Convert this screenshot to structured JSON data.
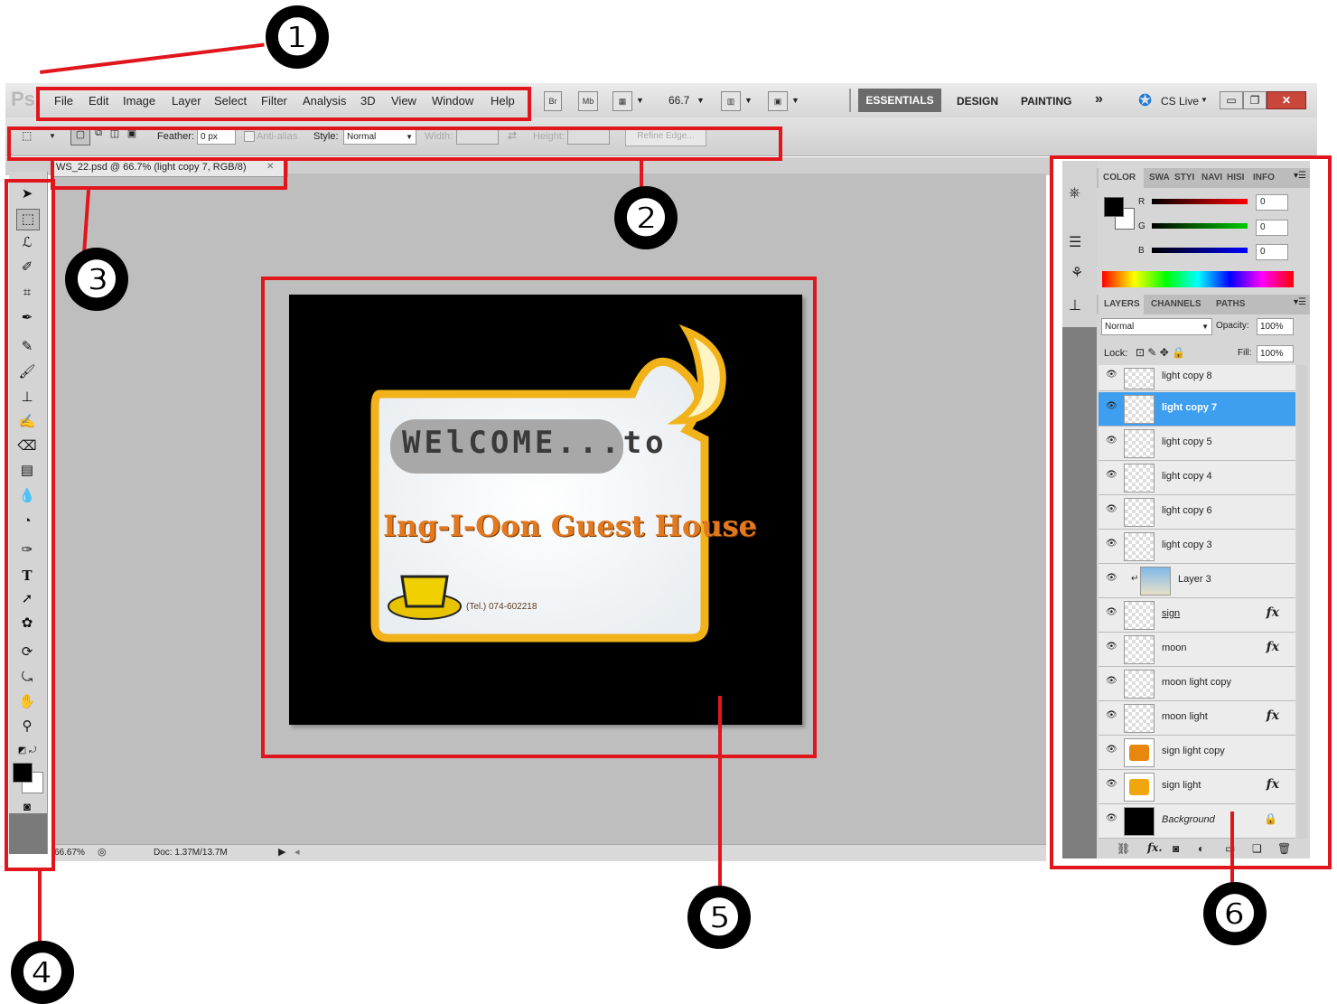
{
  "app": {
    "logo": "Ps"
  },
  "menu": [
    "File",
    "Edit",
    "Image",
    "Layer",
    "Select",
    "Filter",
    "Analysis",
    "3D",
    "View",
    "Window",
    "Help"
  ],
  "app_bar": {
    "br": "Br",
    "mb": "Mb",
    "zoom": "66.7",
    "zoom_arrow": "▼"
  },
  "workspaces": {
    "essentials": "ESSENTIALS",
    "design": "DESIGN",
    "painting": "PAINTING",
    "more": "»",
    "cslive": "CS Live"
  },
  "options": {
    "feather_label": "Feather:",
    "feather_value": "0 px",
    "antialias_label": "Anti-alias",
    "style_label": "Style:",
    "style_value": "Normal",
    "width_label": "Width:",
    "height_label": "Height:",
    "refine_edge": "Refine Edge..."
  },
  "document": {
    "tab_title": "WS_22.psd @ 66.7% (light copy 7, RGB/8)",
    "close": "✕",
    "zoom_status": "66.67%",
    "doc_size": "Doc: 1.37M/13.7M"
  },
  "image": {
    "welcome": "WElCOME...to",
    "name": "Ing-I-Oon Guest House",
    "tel": "(Tel.) 074-602218"
  },
  "colors": {
    "accent": "#3e9ff0",
    "annotation": "#e0161c",
    "panel": "#d6d6d6",
    "essentials_bg": "#6b6b6b"
  },
  "color_panel": {
    "tabs": [
      "COLOR",
      "SWA",
      "STYI",
      "NAVI",
      "HISI",
      "INFO"
    ],
    "r_label": "R",
    "g_label": "G",
    "b_label": "B",
    "r": "0",
    "g": "0",
    "b": "0"
  },
  "layers_panel": {
    "tabs": [
      "LAYERS",
      "CHANNELS",
      "PATHS"
    ],
    "blend_mode": "Normal",
    "opacity_label": "Opacity:",
    "opacity": "100%",
    "lock_label": "Lock:",
    "fill_label": "Fill:",
    "fill": "100%",
    "layers": [
      {
        "name": "light copy 8",
        "fx": ""
      },
      {
        "name": "light copy 7",
        "fx": ""
      },
      {
        "name": "light copy 5",
        "fx": ""
      },
      {
        "name": "light copy 4",
        "fx": ""
      },
      {
        "name": "light copy 6",
        "fx": ""
      },
      {
        "name": "light copy 3",
        "fx": ""
      },
      {
        "name": "Layer 3",
        "fx": ""
      },
      {
        "name": "sign",
        "fx": "fx"
      },
      {
        "name": "moon",
        "fx": "fx"
      },
      {
        "name": "moon light copy",
        "fx": ""
      },
      {
        "name": "moon light",
        "fx": "fx"
      },
      {
        "name": "sign light copy",
        "fx": ""
      },
      {
        "name": "sign light",
        "fx": "fx"
      },
      {
        "name": "Background",
        "fx": ""
      }
    ],
    "footer_fx": "fx."
  },
  "annotations": [
    "❶",
    "❷",
    "❸",
    "❹",
    "❺",
    "❻"
  ]
}
